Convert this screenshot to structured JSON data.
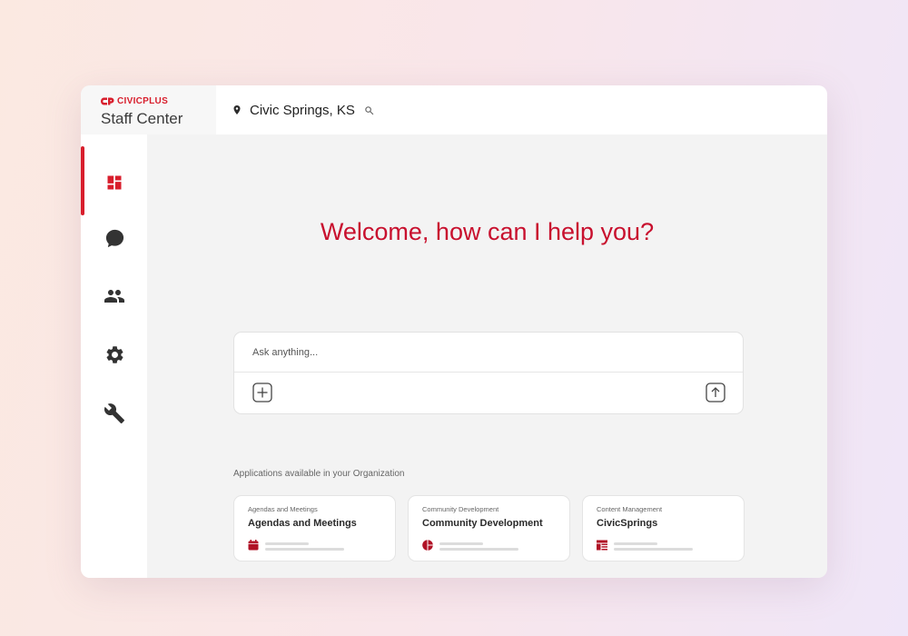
{
  "brand": {
    "logo_text": "CIVICPLUS",
    "app_name": "Staff Center"
  },
  "topbar": {
    "location": "Civic Springs, KS"
  },
  "sidebar": {
    "items": [
      {
        "icon": "dashboard-icon",
        "active": true
      },
      {
        "icon": "chat-icon",
        "active": false
      },
      {
        "icon": "people-icon",
        "active": false
      },
      {
        "icon": "gear-icon",
        "active": false
      },
      {
        "icon": "wrench-icon",
        "active": false
      }
    ]
  },
  "main": {
    "welcome": "Welcome, how can I help you?",
    "ask_placeholder": "Ask anything...",
    "apps_title": "Applications available in your Organization",
    "apps": [
      {
        "category": "Agendas and Meetings",
        "title": "Agendas and Meetings",
        "icon": "calendar-icon"
      },
      {
        "category": "Community Development",
        "title": "Community Development",
        "icon": "community-icon"
      },
      {
        "category": "Content Management",
        "title": "CivicSprings",
        "icon": "content-icon"
      }
    ]
  },
  "colors": {
    "accent": "#d81e2c",
    "welcome_text": "#c8102e",
    "app_icon": "#b01226"
  }
}
